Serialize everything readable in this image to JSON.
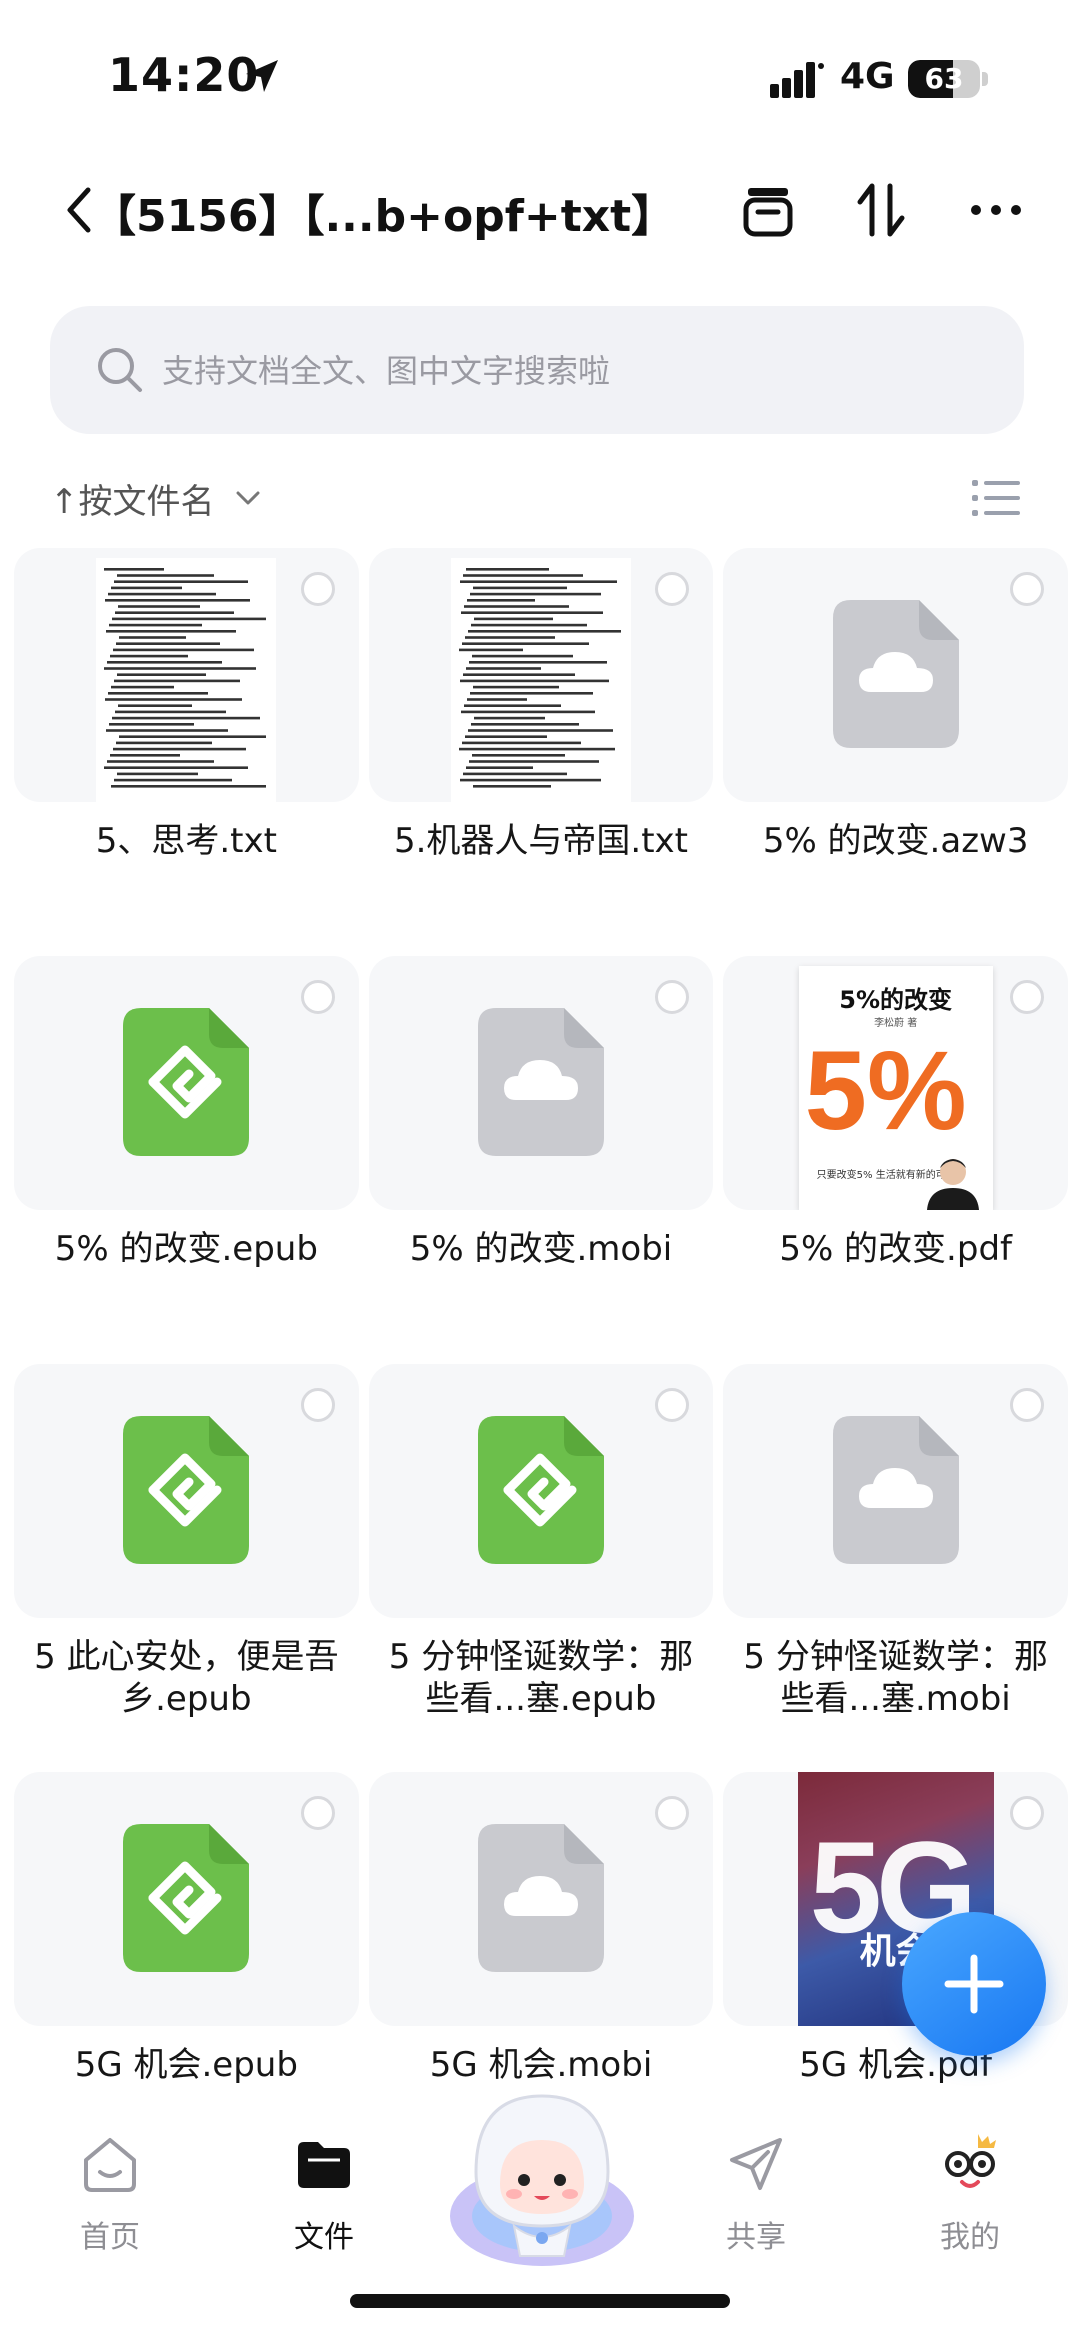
{
  "status_bar": {
    "time": "14:20",
    "network": "4G",
    "battery": "63",
    "battery_level": 0.63
  },
  "header": {
    "title": "【5156】【...b+opf+txt】",
    "icons": [
      "back-icon",
      "archive-icon",
      "sort-arrows-icon",
      "more-icon"
    ]
  },
  "search": {
    "placeholder": "支持文档全文、图中文字搜索啦"
  },
  "sort": {
    "label": "↑按文件名"
  },
  "files": [
    {
      "name": "5、思考.txt",
      "thumb": "txt-preview"
    },
    {
      "name": "5.机器人与帝国.txt",
      "thumb": "txt-preview"
    },
    {
      "name": "5% 的改变.azw3",
      "thumb": "cloud-file-icon"
    },
    {
      "name": "5% 的改变.epub",
      "thumb": "epub-icon"
    },
    {
      "name": "5% 的改变.mobi",
      "thumb": "cloud-file-icon"
    },
    {
      "name": "5% 的改变.pdf",
      "thumb": "book-cover"
    },
    {
      "name": "5 此心安处，便是吾乡.epub",
      "thumb": "epub-icon"
    },
    {
      "name": "5 分钟怪诞数学：那些看...塞.epub",
      "thumb": "epub-icon"
    },
    {
      "name": "5 分钟怪诞数学：那些看...塞.mobi",
      "thumb": "cloud-file-icon"
    },
    {
      "name": "5G 机会.epub",
      "thumb": "epub-icon"
    },
    {
      "name": "5G 机会.mobi",
      "thumb": "cloud-file-icon"
    },
    {
      "name": "5G 机会.pdf",
      "thumb": "book-cover"
    }
  ],
  "covers": {
    "five_percent": {
      "title": "5%的改变",
      "author": "李松蔚 著",
      "big": "5%",
      "tagline": "只要改变5%\n生活就有新的可能"
    },
    "five_g": {
      "big": "5G",
      "title": "机会"
    }
  },
  "tabs": [
    {
      "label": "首页",
      "icon": "home-icon"
    },
    {
      "label": "文件",
      "icon": "folder-icon"
    },
    {
      "label": "",
      "icon": "mascot-icon"
    },
    {
      "label": "共享",
      "icon": "share-icon"
    },
    {
      "label": "我的",
      "icon": "profile-icon"
    }
  ],
  "colors": {
    "accent": "#1877f2",
    "epub_green": "#6cbf4b",
    "cloud_gray": "#c9cacf",
    "cover_orange": "#ef6c22"
  }
}
